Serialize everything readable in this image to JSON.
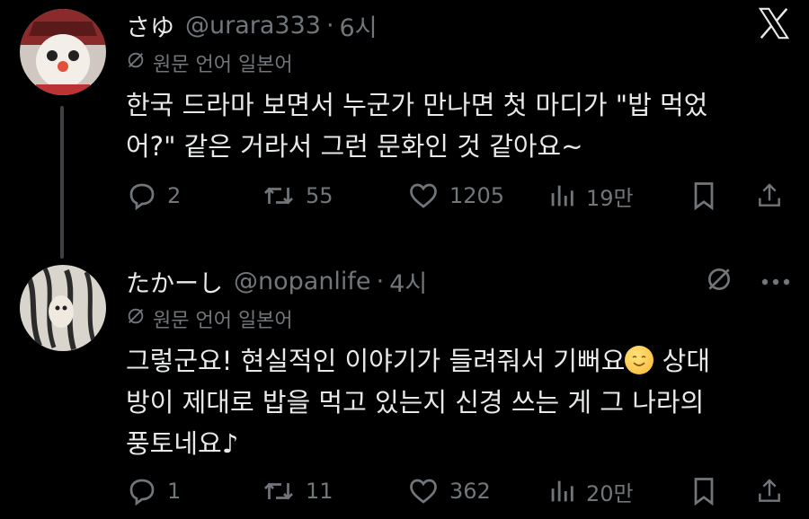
{
  "tweets": [
    {
      "name": "さゆ",
      "handle": "@urara333",
      "separator": "·",
      "time": "6시",
      "lang_note": "원문 언어 일본어",
      "text": "한국 드라마 보면서 누군가 만나면 첫 마디가 \"밥 먹었\n어?\" 같은 거라서 그런 문화인 것 같아요~",
      "replies": "2",
      "reposts": "55",
      "likes": "1205",
      "views": "19만"
    },
    {
      "name": "たかーし",
      "handle": "@nopanlife",
      "separator": "·",
      "time": "4시",
      "lang_note": "원문 언어 일본어",
      "text_line1": "그렇군요! 현실적인 이야기가 들려줘서 기뻐요",
      "text_line1_tail": " 상대",
      "text_rest": "방이 제대로 밥을 먹고 있는지 신경 쓰는 게 그 나라의\n풍토네요♪",
      "replies": "1",
      "reposts": "11",
      "likes": "362",
      "views": "20만"
    }
  ],
  "icons": {
    "close": "x-logo-icon",
    "translate_off": "translate-off-icon",
    "more": "more-icon"
  },
  "colors": {
    "background": "#000000",
    "text": "#e7e9ea",
    "muted": "#71767b"
  }
}
